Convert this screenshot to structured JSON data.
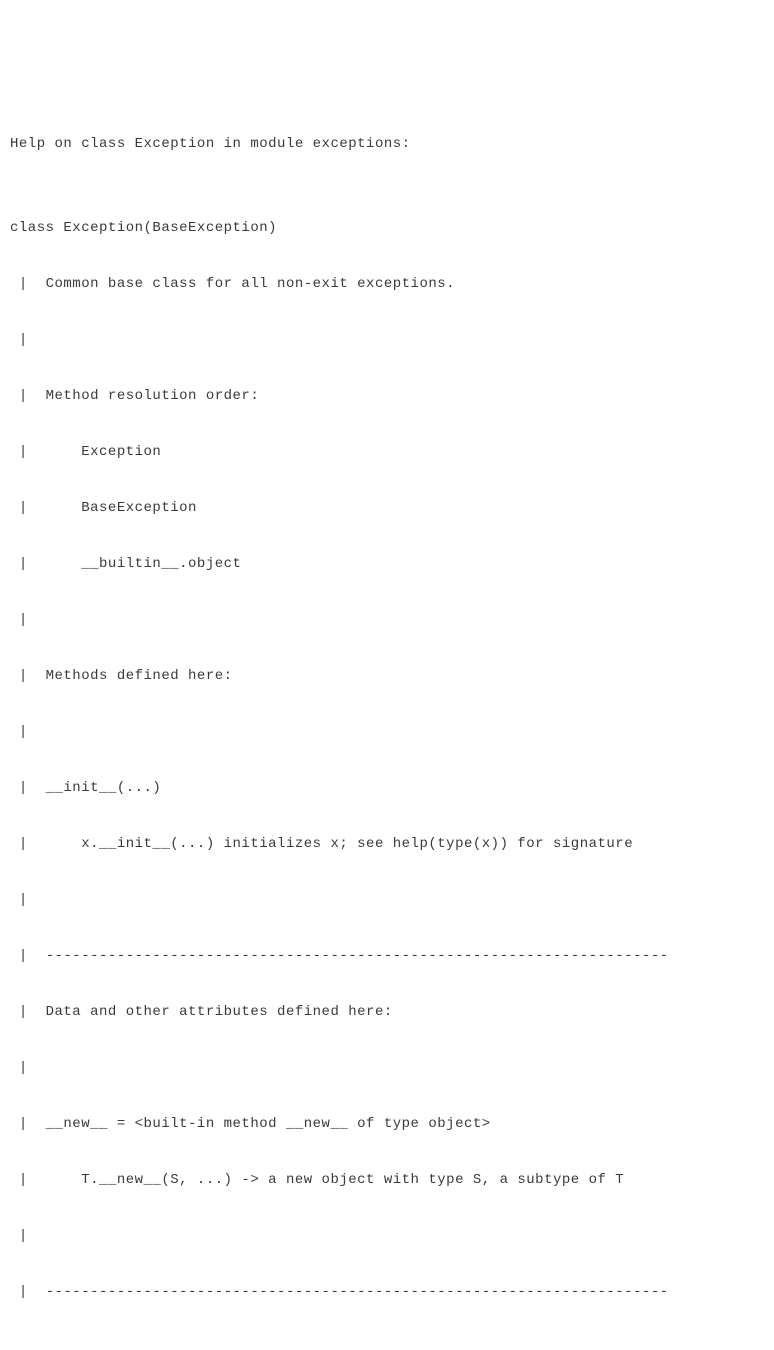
{
  "lines": [
    "Help on class Exception in module exceptions:",
    "",
    "class Exception(BaseException)",
    " |  Common base class for all non-exit exceptions.",
    " |",
    " |  Method resolution order:",
    " |      Exception",
    " |      BaseException",
    " |      __builtin__.object",
    " |",
    " |  Methods defined here:",
    " |",
    " |  __init__(...)",
    " |      x.__init__(...) initializes x; see help(type(x)) for signature",
    " |",
    " |  ----------------------------------------------------------------------",
    " |  Data and other attributes defined here:",
    " |",
    " |  __new__ = <built-in method __new__ of type object>",
    " |      T.__new__(S, ...) -> a new object with type S, a subtype of T",
    " |",
    " |  ----------------------------------------------------------------------"
  ]
}
